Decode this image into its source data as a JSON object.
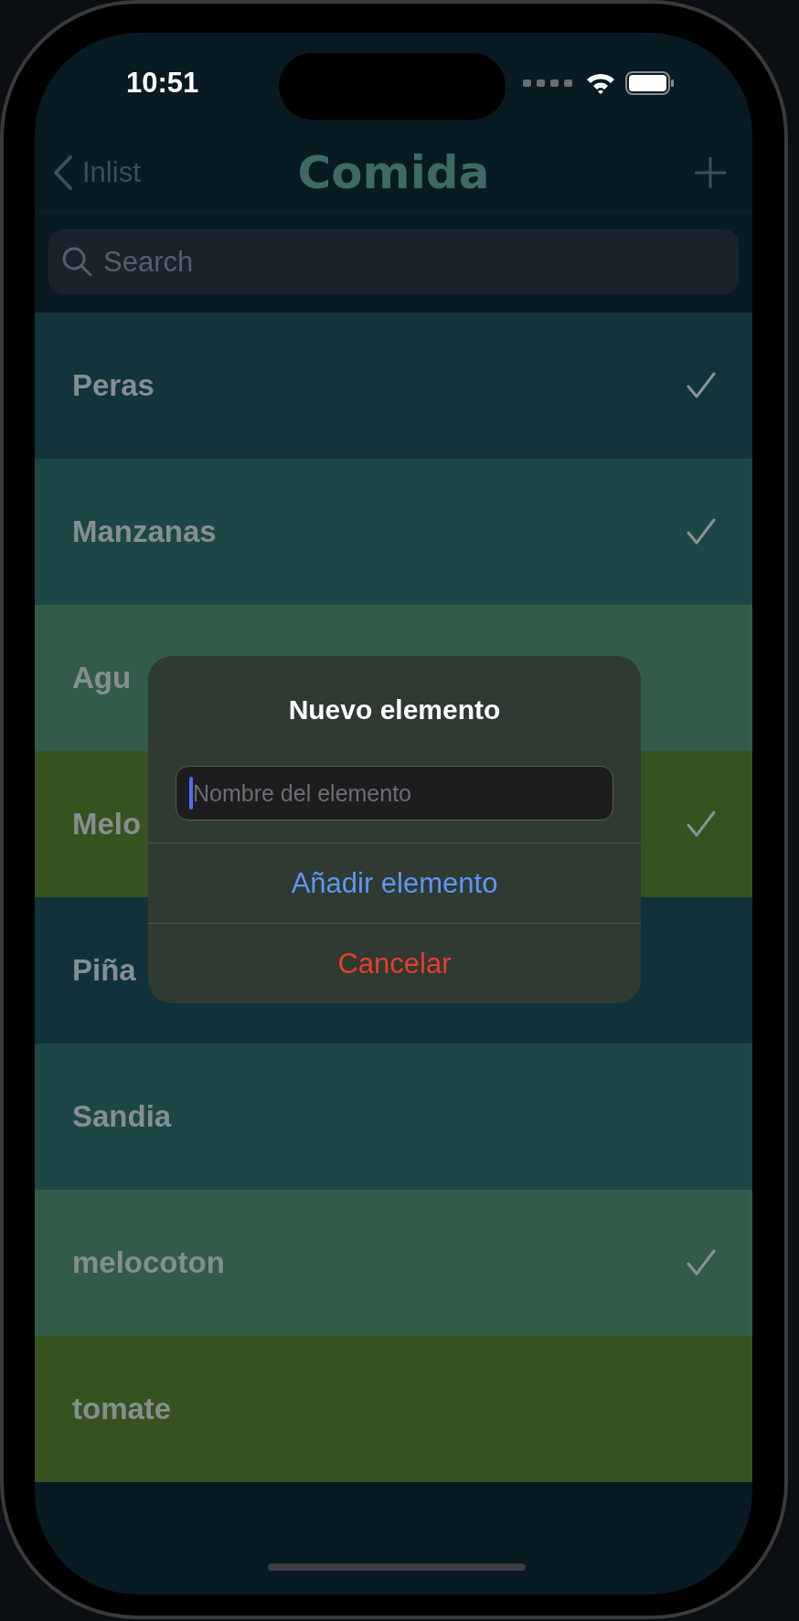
{
  "status_bar": {
    "time": "10:51"
  },
  "nav": {
    "back": "Inlist",
    "title": "Comida"
  },
  "search": {
    "placeholder": "Search"
  },
  "items": [
    {
      "name": "Peras",
      "checked": true,
      "color": "#12343a"
    },
    {
      "name": "Manzanas",
      "checked": true,
      "color": "#1c4747"
    },
    {
      "name": "Agu",
      "checked": false,
      "color": "#335b49"
    },
    {
      "name": "Melo",
      "checked": true,
      "color": "#36521f"
    },
    {
      "name": "Piña",
      "checked": false,
      "color": "#11323a"
    },
    {
      "name": "Sandia",
      "checked": false,
      "color": "#1c4747"
    },
    {
      "name": "melocoton",
      "checked": true,
      "color": "#335b49"
    },
    {
      "name": "tomate",
      "checked": false,
      "color": "#36521f"
    }
  ],
  "dialog": {
    "title": "Nuevo elemento",
    "field": {
      "placeholder": "Nombre del elemento"
    },
    "actions": [
      {
        "label": "Añadir elemento",
        "kind": "default"
      },
      {
        "label": "Cancelar",
        "kind": "destructive"
      }
    ]
  }
}
